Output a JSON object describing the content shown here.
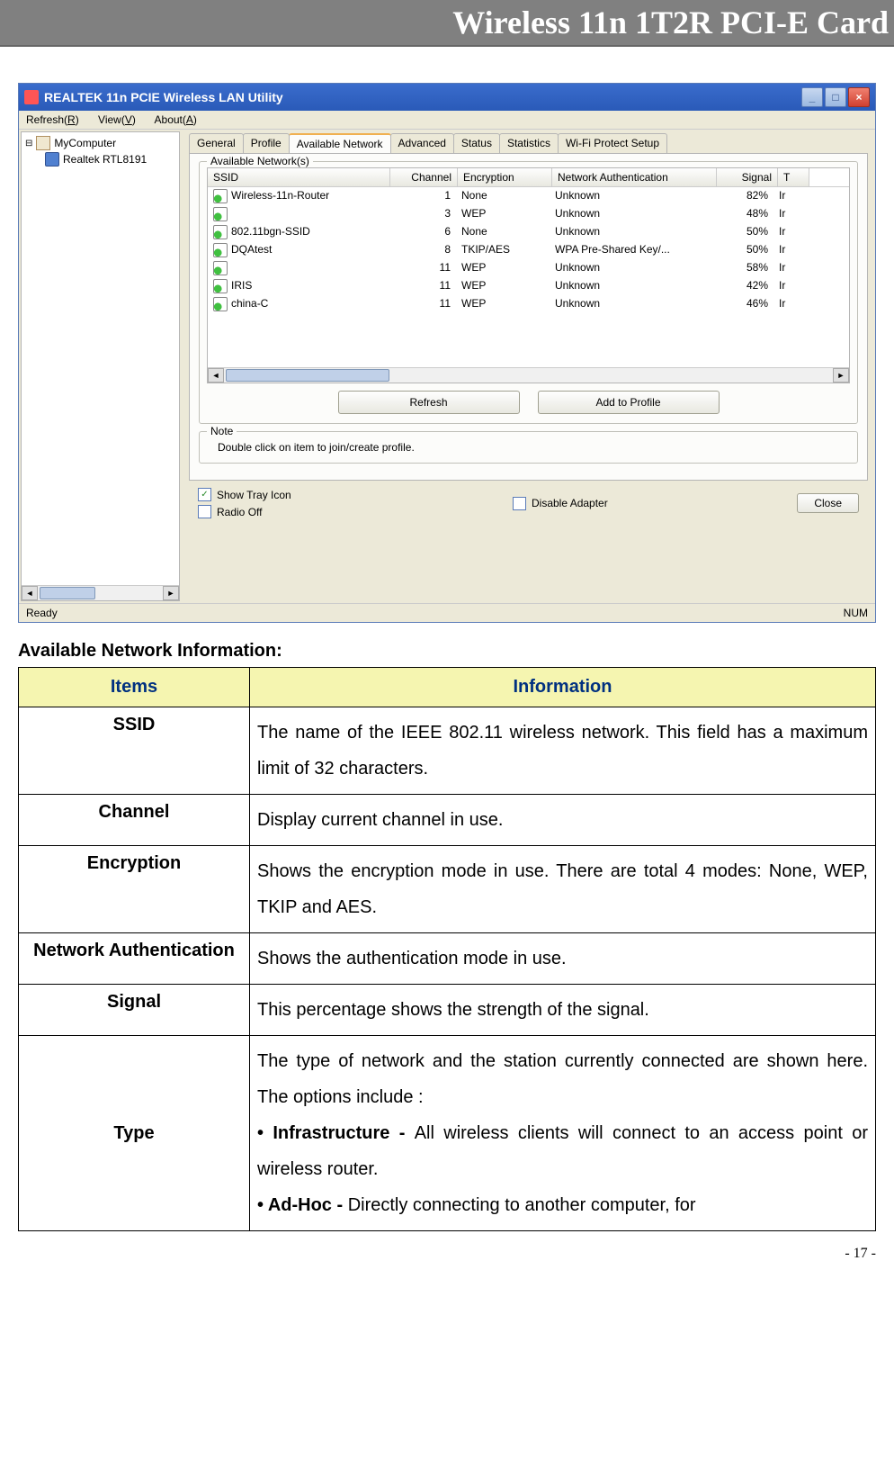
{
  "header": {
    "title": "Wireless 11n 1T2R PCI-E Card"
  },
  "window": {
    "title": "REALTEK 11n PCIE Wireless LAN Utility",
    "menu": {
      "refresh": "Refresh(R)",
      "view": "View(V)",
      "about": "About(A)"
    },
    "tree": {
      "root": "MyComputer",
      "child": "Realtek RTL8191"
    },
    "tabs": [
      "General",
      "Profile",
      "Available Network",
      "Advanced",
      "Status",
      "Statistics",
      "Wi-Fi Protect Setup"
    ],
    "active_tab": "Available Network",
    "fieldset_label": "Available Network(s)",
    "columns": {
      "ssid": "SSID",
      "channel": "Channel",
      "encryption": "Encryption",
      "auth": "Network Authentication",
      "signal": "Signal",
      "type": "T"
    },
    "networks": [
      {
        "ssid": "Wireless-11n-Router",
        "channel": "1",
        "encryption": "None",
        "auth": "Unknown",
        "signal": "82%",
        "type": "Ir"
      },
      {
        "ssid": "",
        "channel": "3",
        "encryption": "WEP",
        "auth": "Unknown",
        "signal": "48%",
        "type": "Ir"
      },
      {
        "ssid": "802.11bgn-SSID",
        "channel": "6",
        "encryption": "None",
        "auth": "Unknown",
        "signal": "50%",
        "type": "Ir"
      },
      {
        "ssid": "DQAtest",
        "channel": "8",
        "encryption": "TKIP/AES",
        "auth": "WPA Pre-Shared Key/...",
        "signal": "50%",
        "type": "Ir"
      },
      {
        "ssid": "",
        "channel": "11",
        "encryption": "WEP",
        "auth": "Unknown",
        "signal": "58%",
        "type": "Ir"
      },
      {
        "ssid": "IRIS",
        "channel": "11",
        "encryption": "WEP",
        "auth": "Unknown",
        "signal": "42%",
        "type": "Ir"
      },
      {
        "ssid": "china-C",
        "channel": "11",
        "encryption": "WEP",
        "auth": "Unknown",
        "signal": "46%",
        "type": "Ir"
      }
    ],
    "buttons": {
      "refresh": "Refresh",
      "add_profile": "Add to Profile"
    },
    "note_label": "Note",
    "note_text": "Double click on item to join/create profile.",
    "options": {
      "show_tray": {
        "label": "Show Tray Icon",
        "checked": true
      },
      "radio_off": {
        "label": "Radio Off",
        "checked": false
      },
      "disable_adapter": {
        "label": "Disable Adapter",
        "checked": false
      }
    },
    "close": "Close",
    "status": {
      "left": "Ready",
      "right": "NUM"
    }
  },
  "section_heading": "Available Network Information:",
  "table": {
    "head": {
      "items": "Items",
      "info": "Information"
    },
    "rows": [
      {
        "item": "SSID",
        "info": "The name of the IEEE 802.11 wireless network. This field has a maximum limit of 32 characters."
      },
      {
        "item": "Channel",
        "info": "Display current channel in use."
      },
      {
        "item": "Encryption",
        "info": "Shows the encryption mode in use. There are total 4 modes: None, WEP, TKIP and AES."
      },
      {
        "item": "Network Authentication",
        "info": "Shows the authentication mode in use."
      },
      {
        "item": "Signal",
        "info": "This percentage shows the strength of the signal."
      }
    ],
    "type_row": {
      "item": "Type",
      "intro": "The type of network and the station currently connected are shown here. The options include :",
      "infra_label": "• Infrastructure - ",
      "infra_text": "All wireless clients will connect to an access point or wireless router.",
      "adhoc_label": "• Ad-Hoc - ",
      "adhoc_text": "Directly connecting to another computer, for"
    }
  },
  "footer": "- 17 -"
}
